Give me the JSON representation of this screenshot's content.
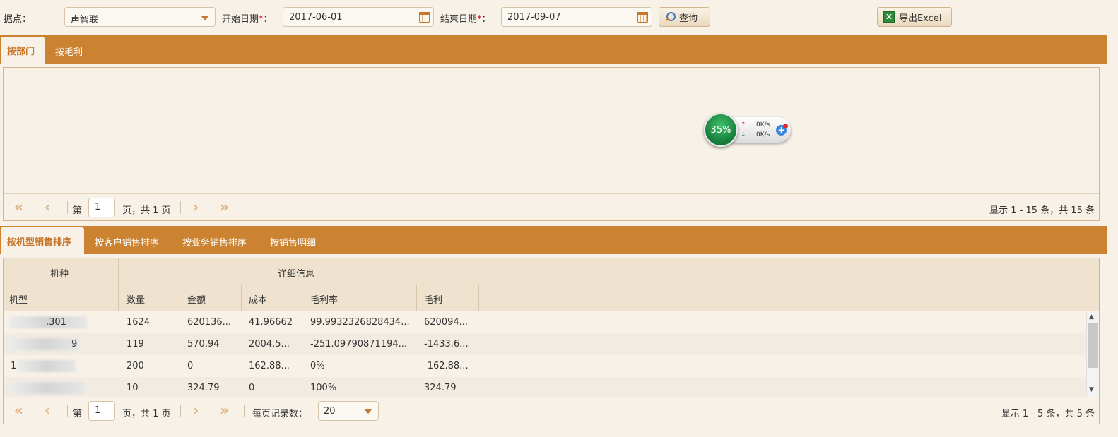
{
  "toolbar": {
    "site_label": "据点：",
    "site_value": "声智联",
    "start_label": "开始日期",
    "start_value": "2017-06-01",
    "end_label": "结束日期",
    "end_value": "2017-09-07",
    "required_mark": "*",
    "colon": "：",
    "query_button": "查询",
    "export_button": "导出Excel"
  },
  "top_tabs": [
    {
      "label": "按部门",
      "active": true
    },
    {
      "label": "按毛利",
      "active": false
    }
  ],
  "top_pager": {
    "page_prefix": "第",
    "page_value": "1",
    "page_suffix": "页，共 1 页",
    "summary": "显示 1 - 15 条，共 15 条"
  },
  "widget": {
    "percent": "35%",
    "up_speed": "0K/s",
    "down_speed": "0K/s",
    "up_arrow": "↑",
    "down_arrow": "↓",
    "plus": "+"
  },
  "bottom_tabs": [
    {
      "label": "按机型销售排序",
      "active": true
    },
    {
      "label": "按客户销售排序",
      "active": false
    },
    {
      "label": "按业务销售排序",
      "active": false
    },
    {
      "label": "按销售明细",
      "active": false
    }
  ],
  "grid": {
    "group_headers": {
      "left": "机种",
      "right": "详细信息"
    },
    "columns": [
      "机型",
      "数量",
      "金额",
      "成本",
      "毛利率",
      "毛利"
    ],
    "rows": [
      {
        "model": ".301",
        "qty": "1624",
        "amount": "620136...",
        "cost": "41.96662",
        "rate": "99.9932326828434...",
        "profit": "620094..."
      },
      {
        "model": "9",
        "qty": "119",
        "amount": "570.94",
        "cost": "2004.5...",
        "rate": "-251.09790871194...",
        "profit": "-1433.6..."
      },
      {
        "model": "1",
        "qty": "200",
        "amount": "0",
        "cost": "162.88...",
        "rate": "0%",
        "profit": "-162.88..."
      },
      {
        "model": "",
        "qty": "10",
        "amount": "324.79",
        "cost": "0",
        "rate": "100%",
        "profit": "324.79"
      }
    ]
  },
  "bottom_pager": {
    "page_prefix": "第",
    "page_value": "1",
    "page_suffix": "页，共 1 页",
    "per_page_label": "每页记录数：",
    "per_page_value": "20",
    "summary": "显示 1 - 5 条，共 5 条"
  },
  "colors": {
    "accent": "#cc8331",
    "background": "#f7f1e8",
    "header": "#efe2cf"
  }
}
